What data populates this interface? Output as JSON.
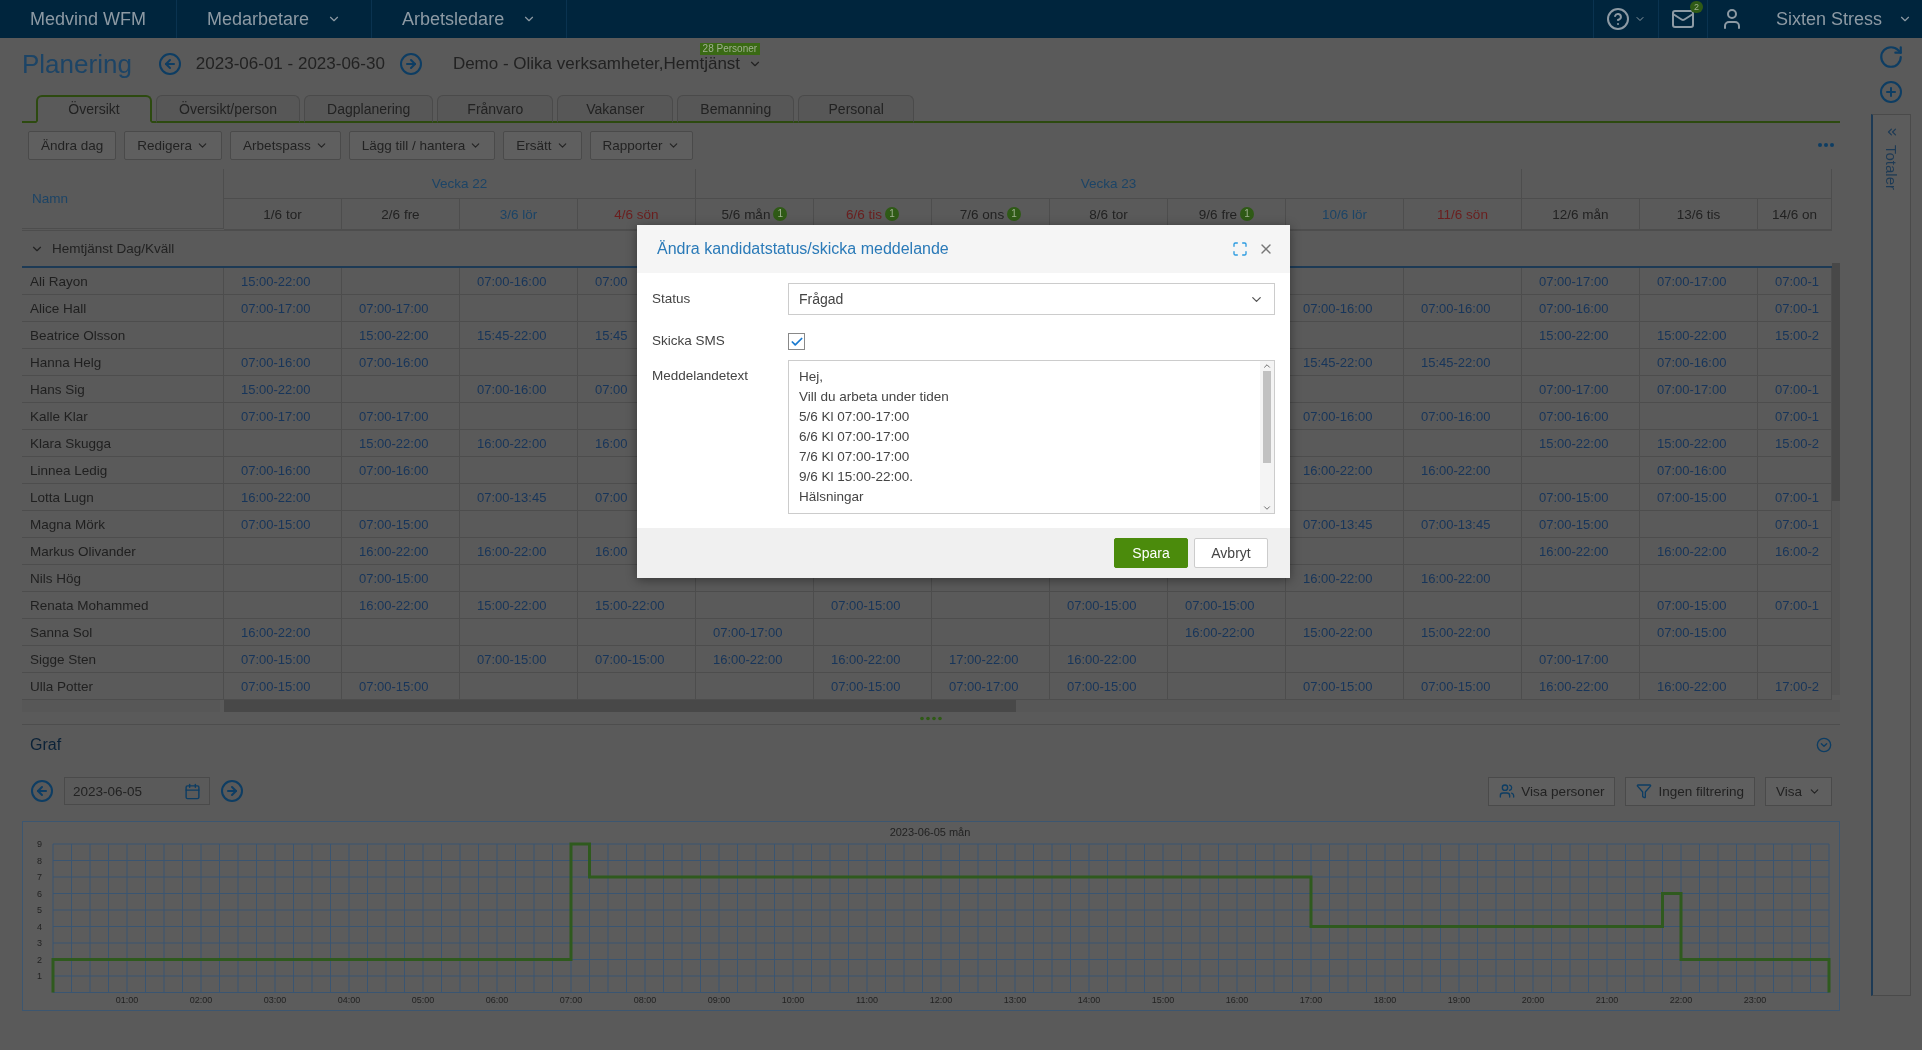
{
  "top_bar": {
    "app_title": "Medvind WFM",
    "menus": [
      {
        "label": "Medarbetare"
      },
      {
        "label": "Arbetsledare"
      }
    ],
    "mail_badge": "2",
    "user_name": "Sixten Stress"
  },
  "header": {
    "title": "Planering",
    "period": "2023-06-01 - 2023-06-30",
    "unit": "Demo - Olika verksamheter,Hemtjänst",
    "unit_badge": "28 Personer"
  },
  "tabs": [
    {
      "label": "Översikt",
      "selected": true
    },
    {
      "label": "Översikt/person",
      "selected": false
    },
    {
      "label": "Dagplanering",
      "selected": false
    },
    {
      "label": "Frånvaro",
      "selected": false
    },
    {
      "label": "Vakanser",
      "selected": false
    },
    {
      "label": "Bemanning",
      "selected": false
    },
    {
      "label": "Personal",
      "selected": false
    }
  ],
  "toolbar": {
    "buttons": [
      {
        "label": "Ändra dag",
        "dropdown": false
      },
      {
        "label": "Redigera",
        "dropdown": true
      },
      {
        "label": "Arbetspass",
        "dropdown": true
      },
      {
        "label": "Lägg till / hantera",
        "dropdown": true
      },
      {
        "label": "Ersätt",
        "dropdown": true
      },
      {
        "label": "Rapporter",
        "dropdown": true
      }
    ]
  },
  "side_panel": {
    "label": "Totaler"
  },
  "schedule": {
    "name_header": "Namn",
    "weeks": [
      {
        "label": "Vecka 22",
        "days": [
          {
            "label": "1/6 tor",
            "kind": "weekday"
          },
          {
            "label": "2/6 fre",
            "kind": "weekday"
          },
          {
            "label": "3/6 lör",
            "kind": "saturday"
          },
          {
            "label": "4/6 sön",
            "kind": "sunday"
          }
        ]
      },
      {
        "label": "Vecka 23",
        "days": [
          {
            "label": "5/6 mån",
            "kind": "weekday",
            "badge": "1"
          },
          {
            "label": "6/6 tis",
            "kind": "sunday",
            "badge": "1"
          },
          {
            "label": "7/6 ons",
            "kind": "weekday",
            "badge": "1"
          },
          {
            "label": "8/6 tor",
            "kind": "weekday"
          },
          {
            "label": "9/6 fre",
            "kind": "weekday",
            "badge": "1"
          },
          {
            "label": "10/6 lör",
            "kind": "saturday"
          },
          {
            "label": "11/6 sön",
            "kind": "sunday"
          }
        ]
      },
      {
        "days": [
          {
            "label": "12/6 mån",
            "kind": "weekday"
          },
          {
            "label": "13/6 tis",
            "kind": "weekday"
          },
          {
            "label": "14/6 on",
            "kind": "weekday"
          }
        ]
      }
    ],
    "group": {
      "name": "Hemtjänst Dag/Kväll",
      "expanded": true
    },
    "rows": [
      {
        "name": "Ali Rayon",
        "shifts": [
          {
            "kind": "shift",
            "time": "15:00-22:00"
          },
          {
            "kind": "empty"
          },
          {
            "kind": "shift",
            "time": "07:00-16:00"
          },
          {
            "kind": "shift",
            "time": "07:00"
          },
          {
            "kind": "hidden"
          },
          {
            "kind": "hidden"
          },
          {
            "kind": "hidden"
          },
          {
            "kind": "hidden"
          },
          {
            "kind": "hidden"
          },
          {
            "kind": "empty"
          },
          {
            "kind": "empty"
          },
          {
            "kind": "shift",
            "time": "07:00-17:00"
          },
          {
            "kind": "shift",
            "time": "07:00-17:00"
          },
          {
            "kind": "shift",
            "time": "07:00-1"
          }
        ]
      },
      {
        "name": "Alice Hall",
        "shifts": [
          {
            "kind": "shift",
            "time": "07:00-17:00"
          },
          {
            "kind": "shift",
            "time": "07:00-17:00"
          },
          {
            "kind": "empty"
          },
          {
            "kind": "empty"
          },
          {
            "kind": "hidden"
          },
          {
            "kind": "hidden"
          },
          {
            "kind": "hidden"
          },
          {
            "kind": "hidden"
          },
          {
            "kind": "hidden"
          },
          {
            "kind": "shift",
            "time": "07:00-16:00"
          },
          {
            "kind": "shift",
            "time": "07:00-16:00"
          },
          {
            "kind": "shift",
            "time": "07:00-16:00"
          },
          {
            "kind": "empty"
          },
          {
            "kind": "shift",
            "time": "07:00-1"
          }
        ]
      },
      {
        "name": "Beatrice Olsson",
        "shifts": [
          {
            "kind": "empty"
          },
          {
            "kind": "shift",
            "time": "15:00-22:00"
          },
          {
            "kind": "shift",
            "time": "15:45-22:00"
          },
          {
            "kind": "shift",
            "time": "15:45"
          },
          {
            "kind": "hidden"
          },
          {
            "kind": "hidden"
          },
          {
            "kind": "hidden"
          },
          {
            "kind": "hidden"
          },
          {
            "kind": "hidden"
          },
          {
            "kind": "empty"
          },
          {
            "kind": "empty"
          },
          {
            "kind": "shift",
            "time": "15:00-22:00"
          },
          {
            "kind": "shift",
            "time": "15:00-22:00"
          },
          {
            "kind": "shift",
            "time": "15:00-2"
          }
        ]
      },
      {
        "name": "Hanna Helg",
        "shifts": [
          {
            "kind": "shift",
            "time": "07:00-16:00"
          },
          {
            "kind": "shift",
            "time": "07:00-16:00"
          },
          {
            "kind": "empty"
          },
          {
            "kind": "empty"
          },
          {
            "kind": "hidden"
          },
          {
            "kind": "hidden"
          },
          {
            "kind": "hidden"
          },
          {
            "kind": "hidden"
          },
          {
            "kind": "hidden"
          },
          {
            "kind": "shift",
            "time": "15:45-22:00"
          },
          {
            "kind": "shift",
            "time": "15:45-22:00"
          },
          {
            "kind": "empty"
          },
          {
            "kind": "shift",
            "time": "07:00-16:00"
          },
          {
            "kind": "empty"
          }
        ]
      },
      {
        "name": "Hans Sig",
        "shifts": [
          {
            "kind": "shift",
            "time": "15:00-22:00"
          },
          {
            "kind": "empty"
          },
          {
            "kind": "shift",
            "time": "07:00-16:00"
          },
          {
            "kind": "shift",
            "time": "07:00"
          },
          {
            "kind": "hidden"
          },
          {
            "kind": "hidden"
          },
          {
            "kind": "hidden"
          },
          {
            "kind": "hidden"
          },
          {
            "kind": "hidden"
          },
          {
            "kind": "empty"
          },
          {
            "kind": "empty"
          },
          {
            "kind": "shift",
            "time": "07:00-17:00"
          },
          {
            "kind": "shift",
            "time": "07:00-17:00"
          },
          {
            "kind": "shift",
            "time": "07:00-1"
          }
        ]
      },
      {
        "name": "Kalle Klar",
        "shifts": [
          {
            "kind": "shift",
            "time": "07:00-17:00"
          },
          {
            "kind": "shift",
            "time": "07:00-17:00"
          },
          {
            "kind": "empty"
          },
          {
            "kind": "empty"
          },
          {
            "kind": "hidden"
          },
          {
            "kind": "hidden"
          },
          {
            "kind": "hidden"
          },
          {
            "kind": "hidden"
          },
          {
            "kind": "hidden"
          },
          {
            "kind": "shift",
            "time": "07:00-16:00"
          },
          {
            "kind": "shift",
            "time": "07:00-16:00"
          },
          {
            "kind": "shift",
            "time": "07:00-16:00"
          },
          {
            "kind": "empty"
          },
          {
            "kind": "shift",
            "time": "07:00-1"
          }
        ]
      },
      {
        "name": "Klara Skugga",
        "shifts": [
          {
            "kind": "empty"
          },
          {
            "kind": "shift",
            "time": "15:00-22:00"
          },
          {
            "kind": "shift",
            "time": "16:00-22:00"
          },
          {
            "kind": "shift",
            "time": "16:00"
          },
          {
            "kind": "hidden"
          },
          {
            "kind": "hidden"
          },
          {
            "kind": "hidden"
          },
          {
            "kind": "hidden"
          },
          {
            "kind": "hidden"
          },
          {
            "kind": "empty"
          },
          {
            "kind": "empty"
          },
          {
            "kind": "shift",
            "time": "15:00-22:00"
          },
          {
            "kind": "shift",
            "time": "15:00-22:00"
          },
          {
            "kind": "shift",
            "time": "15:00-2"
          }
        ]
      },
      {
        "name": "Linnea Ledig",
        "shifts": [
          {
            "kind": "shift",
            "time": "07:00-16:00"
          },
          {
            "kind": "shift",
            "time": "07:00-16:00"
          },
          {
            "kind": "empty"
          },
          {
            "kind": "empty"
          },
          {
            "kind": "hidden"
          },
          {
            "kind": "hidden"
          },
          {
            "kind": "hidden"
          },
          {
            "kind": "hidden"
          },
          {
            "kind": "hidden"
          },
          {
            "kind": "shift",
            "time": "16:00-22:00"
          },
          {
            "kind": "shift",
            "time": "16:00-22:00"
          },
          {
            "kind": "empty"
          },
          {
            "kind": "shift",
            "time": "07:00-16:00"
          },
          {
            "kind": "empty"
          }
        ]
      },
      {
        "name": "Lotta Lugn",
        "shifts": [
          {
            "kind": "shift",
            "time": "16:00-22:00"
          },
          {
            "kind": "empty"
          },
          {
            "kind": "shift",
            "time": "07:00-13:45"
          },
          {
            "kind": "shift",
            "time": "07:00"
          },
          {
            "kind": "hidden"
          },
          {
            "kind": "hidden"
          },
          {
            "kind": "hidden"
          },
          {
            "kind": "hidden"
          },
          {
            "kind": "hidden"
          },
          {
            "kind": "empty"
          },
          {
            "kind": "empty"
          },
          {
            "kind": "shift",
            "time": "07:00-15:00"
          },
          {
            "kind": "shift",
            "time": "07:00-15:00"
          },
          {
            "kind": "shift",
            "time": "07:00-1"
          }
        ]
      },
      {
        "name": "Magna Mörk",
        "shifts": [
          {
            "kind": "shift",
            "time": "07:00-15:00"
          },
          {
            "kind": "shift",
            "time": "07:00-15:00"
          },
          {
            "kind": "empty"
          },
          {
            "kind": "empty"
          },
          {
            "kind": "hidden"
          },
          {
            "kind": "hidden"
          },
          {
            "kind": "hidden"
          },
          {
            "kind": "hidden"
          },
          {
            "kind": "hidden"
          },
          {
            "kind": "shift",
            "time": "07:00-13:45"
          },
          {
            "kind": "shift",
            "time": "07:00-13:45"
          },
          {
            "kind": "shift",
            "time": "07:00-15:00"
          },
          {
            "kind": "empty"
          },
          {
            "kind": "shift",
            "time": "07:00-1"
          }
        ]
      },
      {
        "name": "Markus Olivander",
        "shifts": [
          {
            "kind": "empty"
          },
          {
            "kind": "shift",
            "time": "16:00-22:00"
          },
          {
            "kind": "shift",
            "time": "16:00-22:00"
          },
          {
            "kind": "shift",
            "time": "16:00"
          },
          {
            "kind": "hidden"
          },
          {
            "kind": "hidden"
          },
          {
            "kind": "hidden"
          },
          {
            "kind": "hidden"
          },
          {
            "kind": "hidden"
          },
          {
            "kind": "empty"
          },
          {
            "kind": "empty"
          },
          {
            "kind": "shift",
            "time": "16:00-22:00"
          },
          {
            "kind": "shift",
            "time": "16:00-22:00"
          },
          {
            "kind": "shift",
            "time": "16:00-2"
          }
        ]
      },
      {
        "name": "Nils Hög",
        "shifts": [
          {
            "kind": "empty"
          },
          {
            "kind": "shift",
            "time": "07:00-15:00"
          },
          {
            "kind": "empty"
          },
          {
            "kind": "empty"
          },
          {
            "kind": "empty"
          },
          {
            "kind": "empty"
          },
          {
            "kind": "empty"
          },
          {
            "kind": "empty"
          },
          {
            "kind": "empty"
          },
          {
            "kind": "shift",
            "time": "16:00-22:00"
          },
          {
            "kind": "shift",
            "time": "16:00-22:00"
          },
          {
            "kind": "empty"
          },
          {
            "kind": "empty"
          },
          {
            "kind": "empty"
          }
        ]
      },
      {
        "name": "Renata Mohammed",
        "shifts": [
          {
            "kind": "empty"
          },
          {
            "kind": "shift",
            "time": "16:00-22:00"
          },
          {
            "kind": "shift",
            "time": "15:00-22:00"
          },
          {
            "kind": "shift",
            "time": "15:00-22:00"
          },
          {
            "kind": "empty"
          },
          {
            "kind": "shift",
            "time": "07:00-15:00"
          },
          {
            "kind": "empty"
          },
          {
            "kind": "shift",
            "time": "07:00-15:00"
          },
          {
            "kind": "shift",
            "time": "07:00-15:00"
          },
          {
            "kind": "empty"
          },
          {
            "kind": "empty"
          },
          {
            "kind": "empty"
          },
          {
            "kind": "shift",
            "time": "07:00-15:00"
          },
          {
            "kind": "shift",
            "time": "07:00-1"
          }
        ]
      },
      {
        "name": "Sanna Sol",
        "shifts": [
          {
            "kind": "shift",
            "time": "16:00-22:00"
          },
          {
            "kind": "empty"
          },
          {
            "kind": "empty"
          },
          {
            "kind": "empty"
          },
          {
            "kind": "shift",
            "time": "07:00-17:00"
          },
          {
            "kind": "empty"
          },
          {
            "kind": "empty"
          },
          {
            "kind": "empty"
          },
          {
            "kind": "shift",
            "time": "16:00-22:00"
          },
          {
            "kind": "shift",
            "time": "15:00-22:00"
          },
          {
            "kind": "shift",
            "time": "15:00-22:00"
          },
          {
            "kind": "empty"
          },
          {
            "kind": "shift",
            "time": "07:00-15:00"
          },
          {
            "kind": "empty"
          }
        ]
      },
      {
        "name": "Sigge Sten",
        "shifts": [
          {
            "kind": "shift",
            "time": "07:00-15:00"
          },
          {
            "kind": "empty"
          },
          {
            "kind": "shift",
            "time": "07:00-15:00"
          },
          {
            "kind": "shift",
            "time": "07:00-15:00"
          },
          {
            "kind": "shift",
            "time": "16:00-22:00"
          },
          {
            "kind": "shift",
            "time": "16:00-22:00"
          },
          {
            "kind": "shift",
            "time": "17:00-22:00"
          },
          {
            "kind": "shift",
            "time": "16:00-22:00"
          },
          {
            "kind": "empty"
          },
          {
            "kind": "empty"
          },
          {
            "kind": "empty"
          },
          {
            "kind": "shift",
            "time": "07:00-17:00"
          },
          {
            "kind": "empty"
          },
          {
            "kind": "empty"
          }
        ]
      },
      {
        "name": "Ulla Potter",
        "shifts": [
          {
            "kind": "shift",
            "time": "07:00-15:00"
          },
          {
            "kind": "shift",
            "time": "07:00-15:00"
          },
          {
            "kind": "empty"
          },
          {
            "kind": "empty"
          },
          {
            "kind": "empty"
          },
          {
            "kind": "shift",
            "time": "07:00-15:00"
          },
          {
            "kind": "shift",
            "time": "07:00-17:00"
          },
          {
            "kind": "shift",
            "time": "07:00-15:00"
          },
          {
            "kind": "empty"
          },
          {
            "kind": "shift",
            "time": "07:00-15:00"
          },
          {
            "kind": "shift",
            "time": "07:00-15:00"
          },
          {
            "kind": "shift",
            "time": "16:00-22:00"
          },
          {
            "kind": "shift",
            "time": "16:00-22:00"
          },
          {
            "kind": "shift",
            "time": "17:00-2"
          }
        ]
      }
    ]
  },
  "graph": {
    "title": "Graf",
    "date": "2023-06-05",
    "buttons": [
      {
        "label": "Visa personer",
        "kind": "people"
      },
      {
        "label": "Ingen filtrering",
        "kind": "filter"
      },
      {
        "label": "Visa",
        "kind": "menu"
      }
    ],
    "chart_data": {
      "type": "line",
      "title": "2023-06-05 mån",
      "grid": true,
      "x": [
        0,
        0,
        7,
        7,
        7.25,
        7.25,
        17,
        17,
        21.75,
        21.75,
        22,
        22,
        24,
        24
      ],
      "series": [
        {
          "color": "#2f5a1e",
          "values": [
            0,
            2,
            2,
            9,
            9,
            7,
            7,
            4,
            4,
            6,
            6,
            2,
            2,
            0
          ]
        }
      ],
      "xlim": [
        0,
        24
      ],
      "ylim": [
        0,
        9
      ],
      "xticks": [
        {
          "value": 1,
          "label": "01:00"
        },
        {
          "value": 2,
          "label": "02:00"
        },
        {
          "value": 3,
          "label": "03:00"
        },
        {
          "value": 4,
          "label": "04:00"
        },
        {
          "value": 5,
          "label": "05:00"
        },
        {
          "value": 6,
          "label": "06:00"
        },
        {
          "value": 7,
          "label": "07:00"
        },
        {
          "value": 8,
          "label": "08:00"
        },
        {
          "value": 9,
          "label": "09:00"
        },
        {
          "value": 10,
          "label": "10:00"
        },
        {
          "value": 11,
          "label": "11:00"
        },
        {
          "value": 12,
          "label": "12:00"
        },
        {
          "value": 13,
          "label": "13:00"
        },
        {
          "value": 14,
          "label": "14:00"
        },
        {
          "value": 15,
          "label": "15:00"
        },
        {
          "value": 16,
          "label": "16:00"
        },
        {
          "value": 17,
          "label": "17:00"
        },
        {
          "value": 18,
          "label": "18:00"
        },
        {
          "value": 19,
          "label": "19:00"
        },
        {
          "value": 20,
          "label": "20:00"
        },
        {
          "value": 21,
          "label": "21:00"
        },
        {
          "value": 22,
          "label": "22:00"
        },
        {
          "value": 23,
          "label": "23:00"
        }
      ],
      "yticks": [
        {
          "value": 1,
          "label": "1"
        },
        {
          "value": 2,
          "label": "2"
        },
        {
          "value": 3,
          "label": "3"
        },
        {
          "value": 4,
          "label": "4"
        },
        {
          "value": 5,
          "label": "5"
        },
        {
          "value": 6,
          "label": "6"
        },
        {
          "value": 7,
          "label": "7"
        },
        {
          "value": 8,
          "label": "8"
        },
        {
          "value": 9,
          "label": "9"
        }
      ]
    }
  },
  "dialog": {
    "title": "Ändra kandidatstatus/skicka meddelande",
    "fields": [
      {
        "kind": "select",
        "label": "Status",
        "value": "Frågad"
      },
      {
        "kind": "checkbox",
        "label": "Skicka SMS",
        "checked": true
      },
      {
        "kind": "textarea",
        "label": "Meddelandetext",
        "lines": [
          "Hej,",
          "Vill du arbeta under tiden",
          "5/6 Kl 07:00-17:00",
          "6/6 Kl 07:00-17:00",
          "7/6 Kl 07:00-17:00",
          "9/6 Kl 15:00-22:00.",
          "Hälsningar"
        ]
      }
    ],
    "buttons": [
      {
        "label": "Spara",
        "primary": true
      },
      {
        "label": "Avbryt",
        "primary": false
      }
    ]
  }
}
